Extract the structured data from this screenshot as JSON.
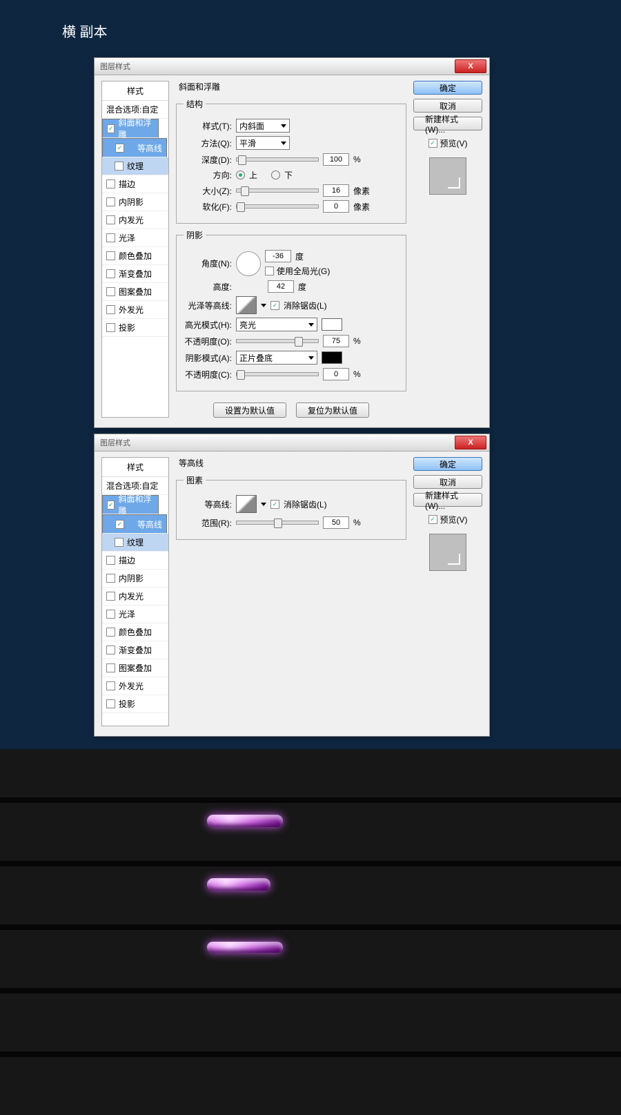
{
  "page_title": "横 副本",
  "dialog1": {
    "title": "图层样式",
    "left": {
      "header": "样式",
      "blend": "混合选项:自定",
      "items": [
        {
          "label": "斜面和浮雕",
          "checked": true,
          "selected": true
        },
        {
          "label": "等高线",
          "sub": true,
          "checked": true,
          "selected": true
        },
        {
          "label": "纹理",
          "sub": true,
          "checked": false,
          "selected": false
        },
        {
          "label": "描边",
          "checked": false
        },
        {
          "label": "内阴影",
          "checked": false
        },
        {
          "label": "内发光",
          "checked": false
        },
        {
          "label": "光泽",
          "checked": false
        },
        {
          "label": "颜色叠加",
          "checked": false
        },
        {
          "label": "渐变叠加",
          "checked": false
        },
        {
          "label": "图案叠加",
          "checked": false
        },
        {
          "label": "外发光",
          "checked": false
        },
        {
          "label": "投影",
          "checked": false
        }
      ]
    },
    "panel_title": "斜面和浮雕",
    "structure": {
      "legend": "结构",
      "style_label": "样式(T):",
      "style_value": "内斜面",
      "tech_label": "方法(Q):",
      "tech_value": "平滑",
      "depth_label": "深度(D):",
      "depth_value": "100",
      "percent": "%",
      "dir_label": "方向:",
      "dir_up": "上",
      "dir_down": "下",
      "size_label": "大小(Z):",
      "size_value": "16",
      "px": "像素",
      "soft_label": "软化(F):",
      "soft_value": "0"
    },
    "shading": {
      "legend": "阴影",
      "angle_label": "角度(N):",
      "angle_value": "-36",
      "deg": "度",
      "global": "使用全局光(G)",
      "alt_label": "高度:",
      "alt_value": "42",
      "gloss_label": "光泽等高线:",
      "aa": "消除锯齿(L)",
      "hi_label": "高光模式(H):",
      "hi_value": "亮光",
      "hi_op_label": "不透明度(O):",
      "hi_op_value": "75",
      "sh_label": "阴影模式(A):",
      "sh_value": "正片叠底",
      "sh_op_label": "不透明度(C):",
      "sh_op_value": "0"
    },
    "bottom": {
      "default": "设置为默认值",
      "reset": "复位为默认值"
    },
    "right": {
      "ok": "确定",
      "cancel": "取消",
      "new": "新建样式(W)...",
      "preview": "预览(V)"
    }
  },
  "dialog2": {
    "title": "图层样式",
    "panel_title": "等高线",
    "el": {
      "legend": "图素",
      "contour_label": "等高线:",
      "aa": "消除锯齿(L)",
      "range_label": "范围(R):",
      "range_value": "50",
      "percent": "%"
    }
  }
}
